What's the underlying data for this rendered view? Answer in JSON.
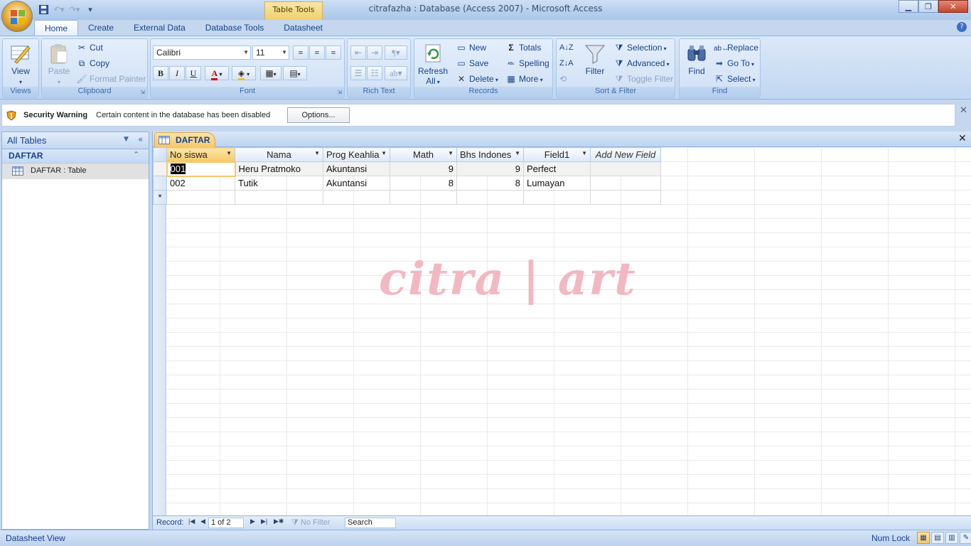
{
  "window": {
    "title": "citrafazha : Database (Access 2007) - Microsoft Access",
    "context_tab": "Table Tools"
  },
  "ribbon_tabs": [
    "Home",
    "Create",
    "External Data",
    "Database Tools",
    "Datasheet"
  ],
  "ribbon": {
    "views": {
      "view_label": "View",
      "group": "Views"
    },
    "clipboard": {
      "paste": "Paste",
      "cut": "Cut",
      "copy": "Copy",
      "format_painter": "Format Painter",
      "group": "Clipboard"
    },
    "font": {
      "font_name": "Calibri",
      "font_size": "11",
      "bold": "B",
      "italic": "I",
      "underline": "U",
      "group": "Font"
    },
    "rich_text": {
      "group": "Rich Text"
    },
    "records": {
      "refresh": "Refresh",
      "refresh_all": "All",
      "new": "New",
      "save": "Save",
      "delete": "Delete",
      "totals": "Totals",
      "spelling": "Spelling",
      "more": "More",
      "group": "Records"
    },
    "sort_filter": {
      "filter": "Filter",
      "selection": "Selection",
      "advanced": "Advanced",
      "toggle_filter": "Toggle Filter",
      "group": "Sort & Filter"
    },
    "find": {
      "find": "Find",
      "replace": "Replace",
      "goto": "Go To",
      "select": "Select",
      "group": "Find"
    }
  },
  "security": {
    "title": "Security Warning",
    "message": "Certain content in the database has been disabled",
    "options": "Options..."
  },
  "nav": {
    "header": "All Tables",
    "group": "DAFTAR",
    "item": "DAFTAR : Table"
  },
  "document": {
    "tab": "DAFTAR",
    "columns": [
      "No siswa",
      "Nama",
      "Prog Keahlia",
      "Math",
      "Bhs Indones",
      "Field1",
      "Add New Field"
    ],
    "rows": [
      [
        "001",
        "Heru Pratmoko",
        "Akuntansi",
        "9",
        "9",
        "Perfect",
        ""
      ],
      [
        "002",
        "Tutik",
        "Akuntansi",
        "8",
        "8",
        "Lumayan",
        ""
      ]
    ],
    "new_row_marker": "*",
    "watermark": "citra | art"
  },
  "record_nav": {
    "label": "Record:",
    "position": "1 of 2",
    "no_filter": "No Filter",
    "search": "Search"
  },
  "status": {
    "left": "Datasheet View",
    "num_lock": "Num Lock"
  }
}
